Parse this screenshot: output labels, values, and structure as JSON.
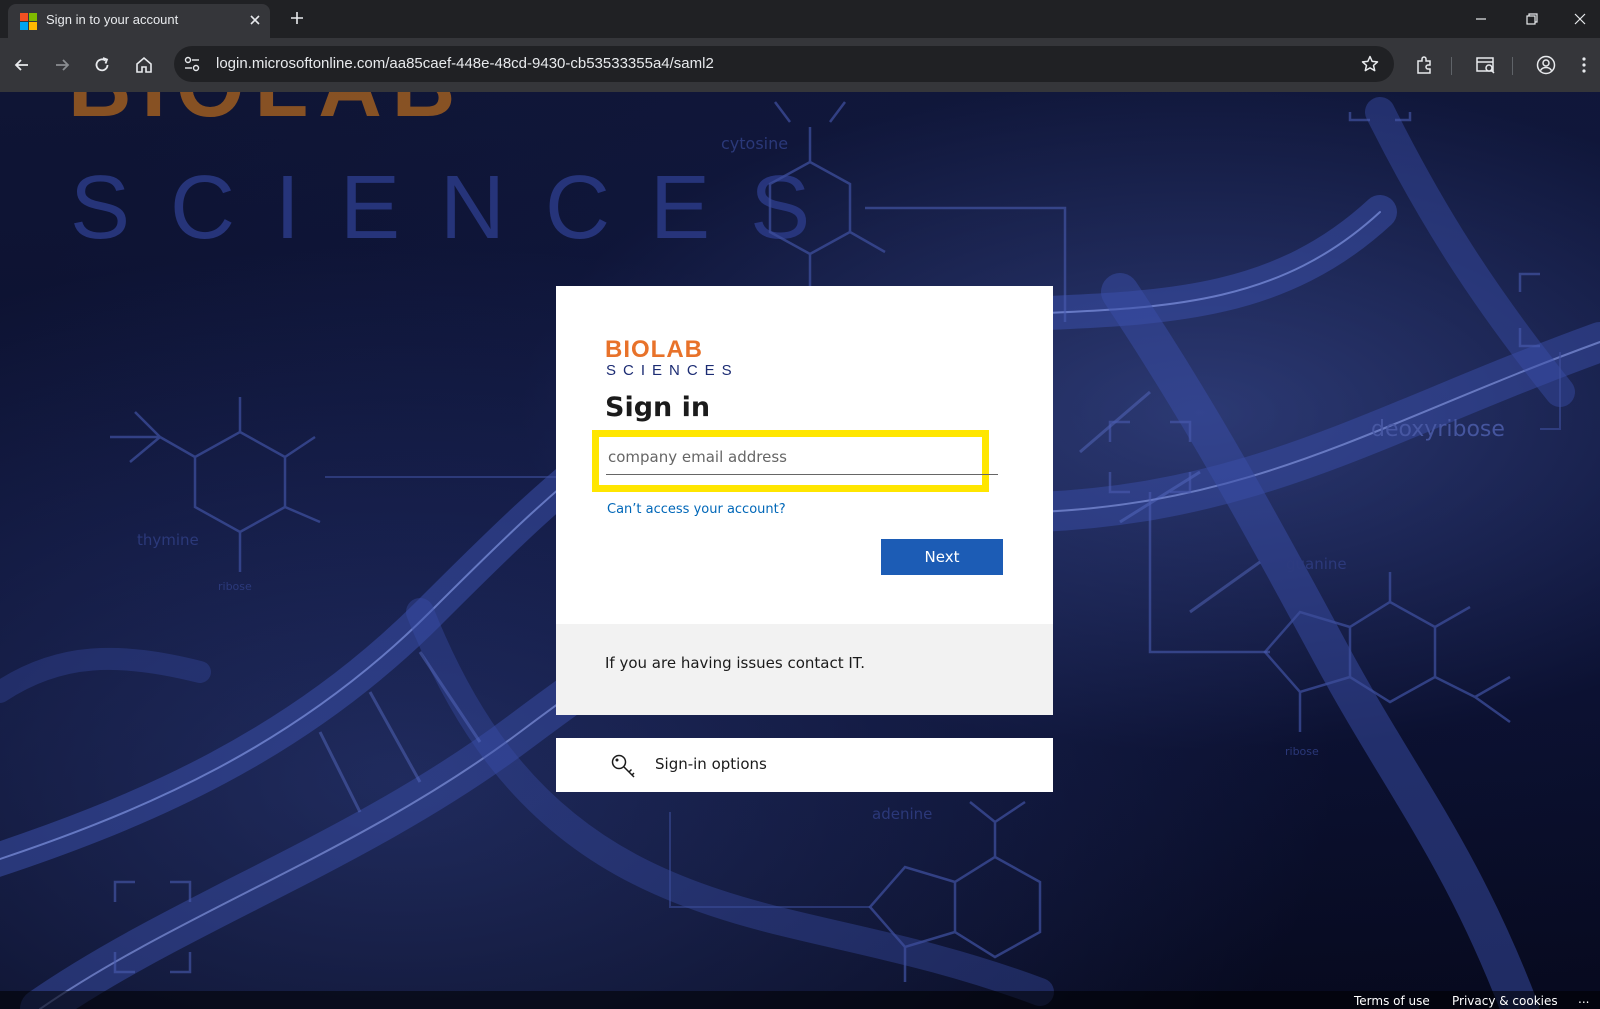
{
  "browser": {
    "tab": {
      "title": "Sign in to your account"
    },
    "url": "login.microsoftonline.com/aa85caef-448e-48cd-9430-cb53533355a4/saml2"
  },
  "background": {
    "brand_word_top": "BIOLAB",
    "brand_word": "SCIENCES",
    "labels": {
      "cytosine": "cytosine",
      "thymine": "thymine",
      "ribose_left": "ribose",
      "deoxyribose": "deoxyribose",
      "guanine": "guanine",
      "ribose_right": "ribose",
      "adenine": "adenine"
    }
  },
  "signin": {
    "logo_top": "BIOLAB",
    "logo_bottom": "SCIENCES",
    "title": "Sign in",
    "email_placeholder": "company email address",
    "cant_access": "Can’t access your account?",
    "next_label": "Next",
    "footer_text": "If you are having issues contact IT.",
    "options_label": "Sign-in options"
  },
  "footer": {
    "terms": "Terms of use",
    "privacy": "Privacy & cookies",
    "more": "..."
  },
  "colors": {
    "accent_blue": "#1c5cb5",
    "link_blue": "#0067b8",
    "highlight_yellow": "#ffe600",
    "logo_orange": "#e8722a",
    "logo_navy": "#1c2c73"
  }
}
